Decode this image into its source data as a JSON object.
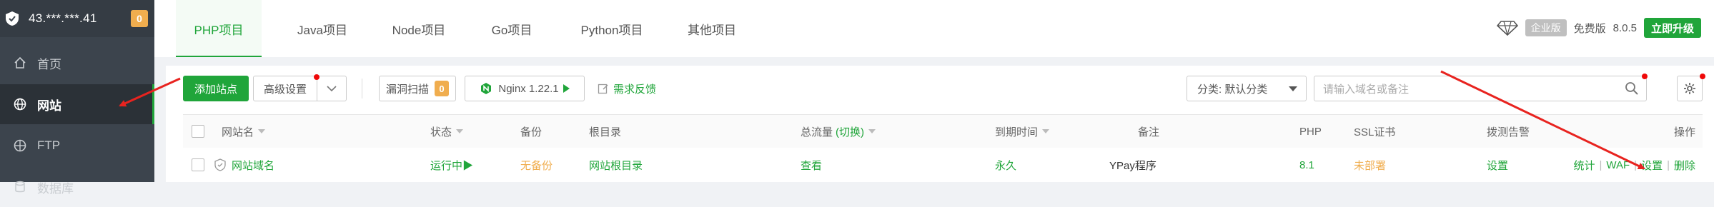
{
  "sidebar": {
    "ip": "43.***.***.41",
    "badge": "0",
    "items": [
      {
        "label": "首页"
      },
      {
        "label": "网站"
      },
      {
        "label": "FTP"
      },
      {
        "label": "数据库"
      }
    ]
  },
  "tabs": [
    "PHP项目",
    "Java项目",
    "Node项目",
    "Go项目",
    "Python项目",
    "其他项目"
  ],
  "version_area": {
    "enterprise": "企业版",
    "free": "免费版",
    "version": "8.0.5",
    "upgrade": "立即升级"
  },
  "toolbar": {
    "add_site": "添加站点",
    "advanced": "高级设置",
    "vuln_scan": "漏洞扫描",
    "vuln_count": "0",
    "nginx": "Nginx 1.22.1",
    "feedback": "需求反馈",
    "category": "分类: 默认分类",
    "search_placeholder": "请输入域名或备注"
  },
  "table": {
    "headers": {
      "site_name": "网站名",
      "status": "状态",
      "backup": "备份",
      "root": "根目录",
      "traffic": "总流量",
      "traffic_switch": "(切换)",
      "expire": "到期时间",
      "remark": "备注",
      "php": "PHP",
      "ssl": "SSL证书",
      "alert": "拨测告警",
      "ops": "操作"
    },
    "rows": [
      {
        "site_name": "网站域名",
        "status": "运行中▶",
        "backup": "无备份",
        "root": "网站根目录",
        "traffic": "查看",
        "expire": "永久",
        "remark": "YPay程序",
        "php": "8.1",
        "ssl": "未部署",
        "alert": "设置",
        "ops": [
          "统计",
          "WAF",
          "设置",
          "删除"
        ]
      }
    ]
  },
  "colors": {
    "brand_green": "#20a53a",
    "sidebar_bg": "#3c444d",
    "warning_orange": "#f0ad4e",
    "arrow_red": "#e8231f"
  }
}
